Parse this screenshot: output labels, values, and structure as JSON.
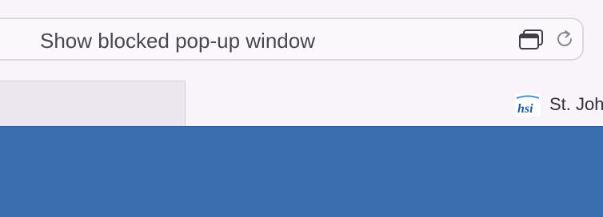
{
  "address_bar": {
    "text": "Show blocked pop-up window",
    "popup_icon": "popup-window-icon",
    "reload_icon": "reload-icon"
  },
  "tabs": [
    {
      "label": "",
      "active": false
    },
    {
      "label": "St. Joh",
      "active": true,
      "favicon_text": "hsi",
      "favicon_icon": "hsi-logo-icon"
    }
  ],
  "colors": {
    "content_bg": "#3a6faf",
    "toolbar_bg": "#f9f4fa",
    "logo_blue": "#1f5b9a",
    "logo_light": "#4a8fd0"
  }
}
